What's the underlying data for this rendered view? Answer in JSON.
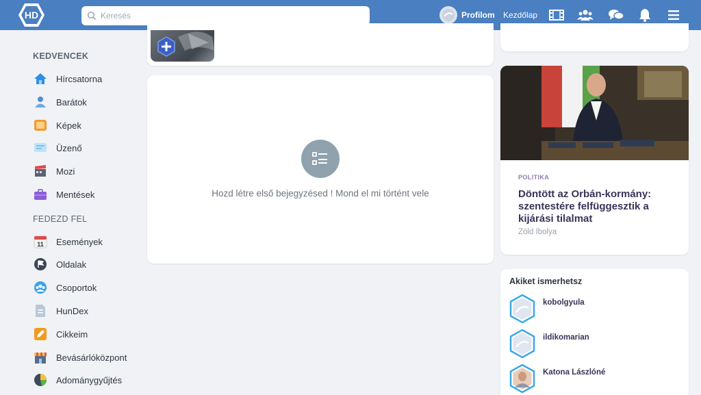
{
  "topbar": {
    "logo_text": "HD",
    "search_placeholder": "Keresés",
    "profile_label": "Profilom",
    "home_label": "Kezdőlap",
    "icons": [
      "film-icon",
      "friends-icon",
      "chat-icon",
      "bell-icon",
      "menu-icon"
    ]
  },
  "sidebar": {
    "favorites_title": "KEDVENCEK",
    "favorites": [
      {
        "label": "Hírcsatorna",
        "icon": "home-icon"
      },
      {
        "label": "Barátok",
        "icon": "friends-icon"
      },
      {
        "label": "Képek",
        "icon": "photos-icon"
      },
      {
        "label": "Üzenő",
        "icon": "message-icon"
      },
      {
        "label": "Mozi",
        "icon": "cinema-icon"
      },
      {
        "label": "Mentések",
        "icon": "briefcase-icon"
      }
    ],
    "explore_title": "FEDEZD FEL",
    "explore": [
      {
        "label": "Események",
        "icon": "calendar-icon",
        "calendar_day": "11"
      },
      {
        "label": "Oldalak",
        "icon": "flag-icon"
      },
      {
        "label": "Csoportok",
        "icon": "groups-icon"
      },
      {
        "label": "HunDex",
        "icon": "document-icon"
      },
      {
        "label": "Cikkeim",
        "icon": "pencil-icon"
      },
      {
        "label": "Bevásárlóközpont",
        "icon": "shop-icon"
      },
      {
        "label": "Adománygyűjtés",
        "icon": "pie-chart-icon"
      }
    ]
  },
  "feed": {
    "empty_message": "Hozd létre első bejegyzésed ! Mond el mi történt vele"
  },
  "news": {
    "category": "POLITIKA",
    "title": "Döntött az Orbán-kormány: szentestére felfüggesztik a kijárási tilalmat",
    "author": "Zöld Ibolya"
  },
  "suggestions": {
    "title": "Akiket ismerhetsz",
    "people": [
      {
        "name": "kobolgyula"
      },
      {
        "name": "ildikomarian"
      },
      {
        "name": "Katona Lászlóné"
      }
    ]
  },
  "colors": {
    "topbar": "#4a7fc1",
    "accent": "#3a3358"
  }
}
